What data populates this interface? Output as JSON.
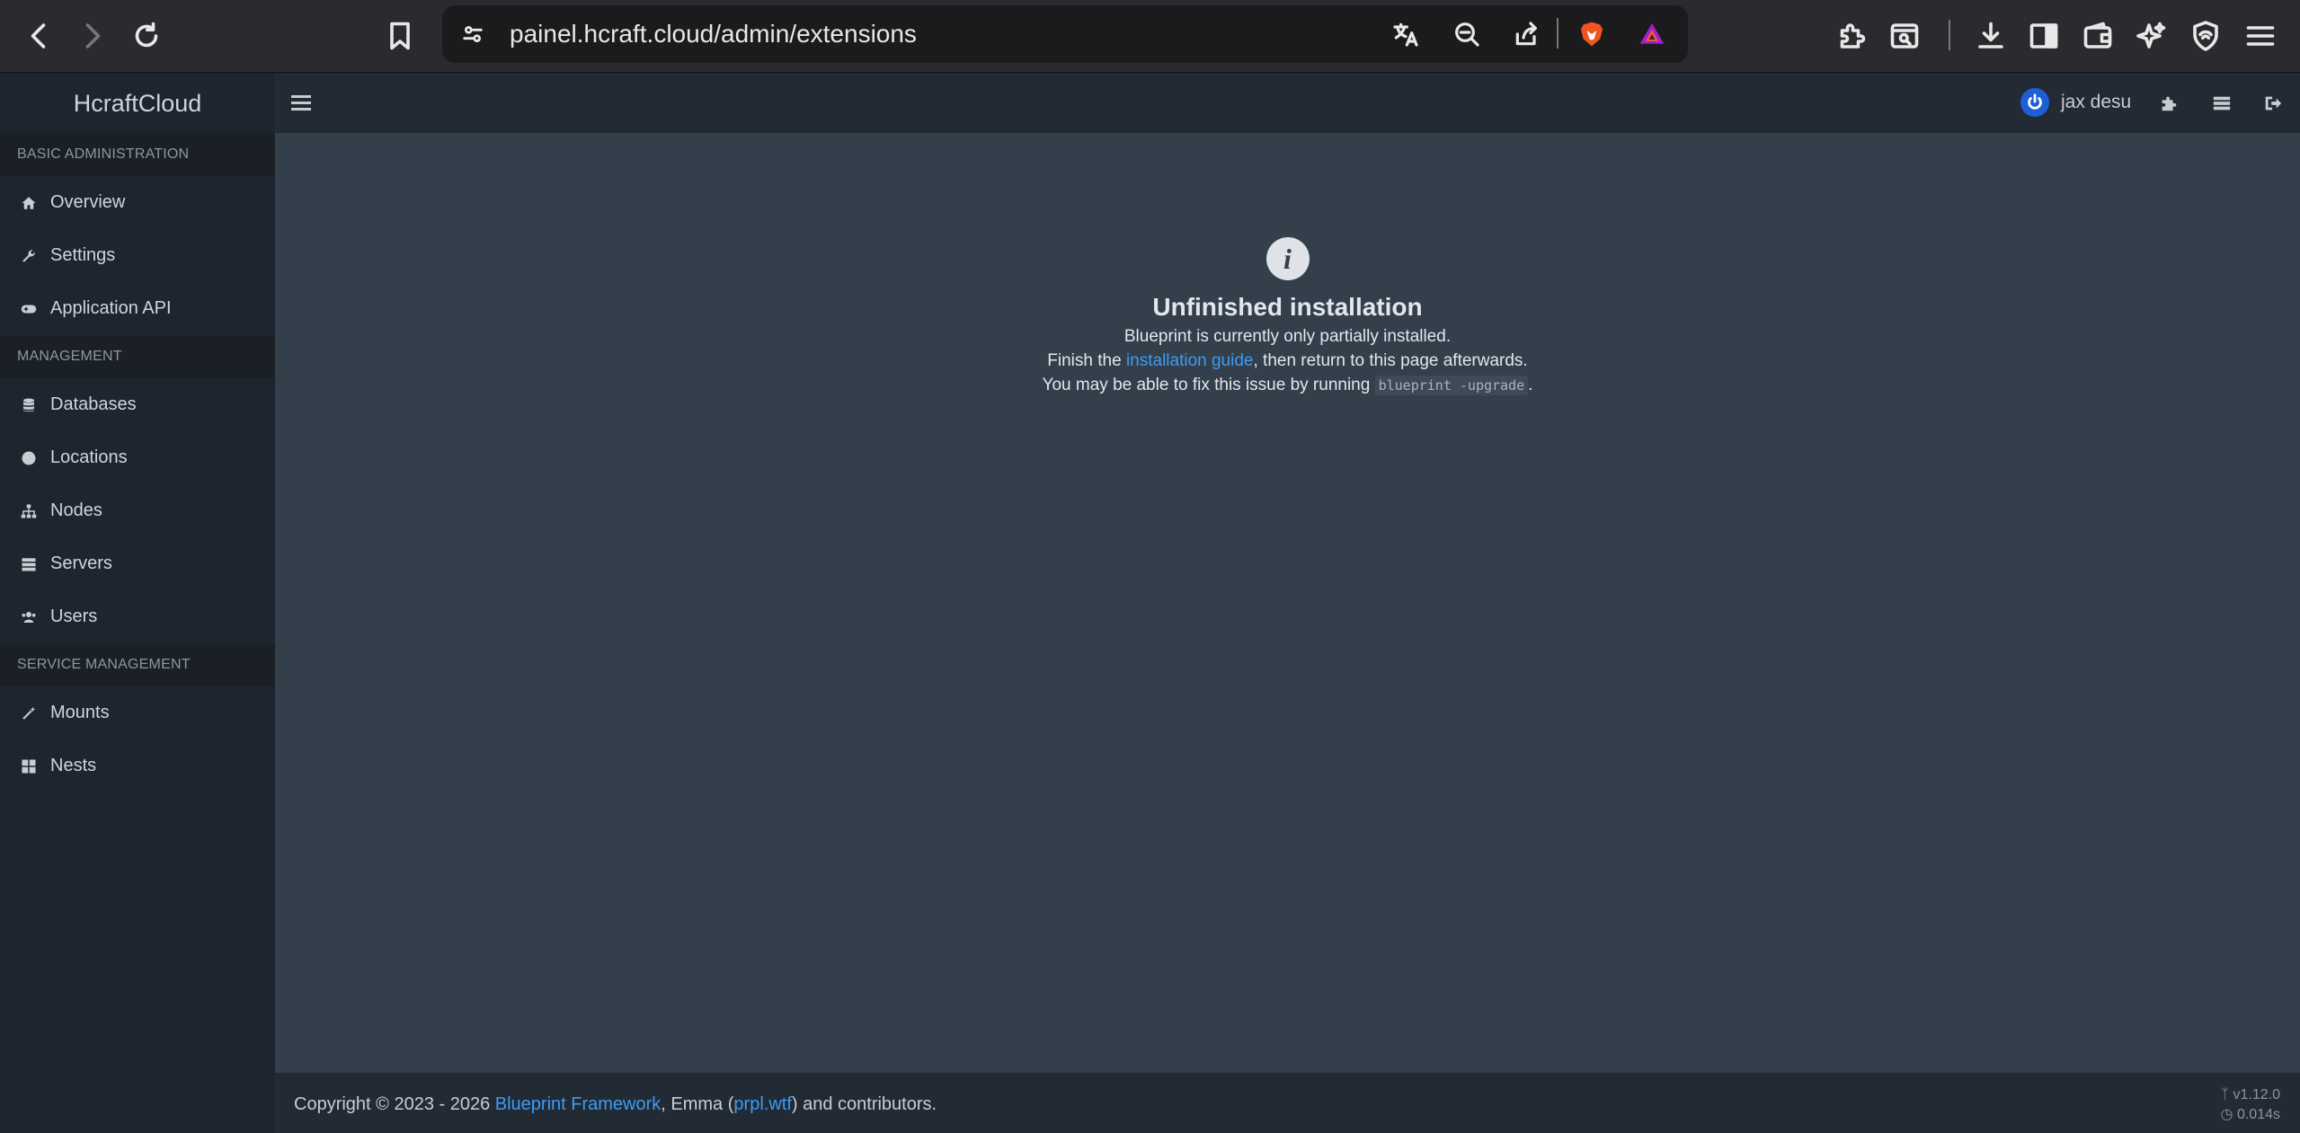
{
  "browser": {
    "url": "painel.hcraft.cloud/admin/extensions"
  },
  "header": {
    "brand": "HcraftCloud",
    "username": "jax desu"
  },
  "sidebar": {
    "sections": [
      {
        "title": "BASIC ADMINISTRATION",
        "items": [
          {
            "label": "Overview",
            "icon": "home-icon"
          },
          {
            "label": "Settings",
            "icon": "wrench-icon"
          },
          {
            "label": "Application API",
            "icon": "gamepad-icon"
          }
        ]
      },
      {
        "title": "MANAGEMENT",
        "items": [
          {
            "label": "Databases",
            "icon": "database-icon"
          },
          {
            "label": "Locations",
            "icon": "globe-icon"
          },
          {
            "label": "Nodes",
            "icon": "sitemap-icon"
          },
          {
            "label": "Servers",
            "icon": "server-icon"
          },
          {
            "label": "Users",
            "icon": "users-icon"
          }
        ]
      },
      {
        "title": "SERVICE MANAGEMENT",
        "items": [
          {
            "label": "Mounts",
            "icon": "magic-icon"
          },
          {
            "label": "Nests",
            "icon": "th-large-icon"
          }
        ]
      }
    ]
  },
  "notice": {
    "title": "Unfinished installation",
    "line1": "Blueprint is currently only partially installed.",
    "line2_pre": "Finish the ",
    "line2_link": "installation guide",
    "line2_post": ", then return to this page afterwards.",
    "line3_pre": "You may be able to fix this issue by running ",
    "line3_code": "blueprint -upgrade",
    "line3_post": "."
  },
  "footer": {
    "text_pre": "Copyright © 2023 - 2026 ",
    "link1": "Blueprint Framework",
    "text_mid": ", Emma (",
    "link2": "prpl.wtf",
    "text_post": ") and contributors.",
    "version": "v1.12.0",
    "time": "0.014s"
  }
}
